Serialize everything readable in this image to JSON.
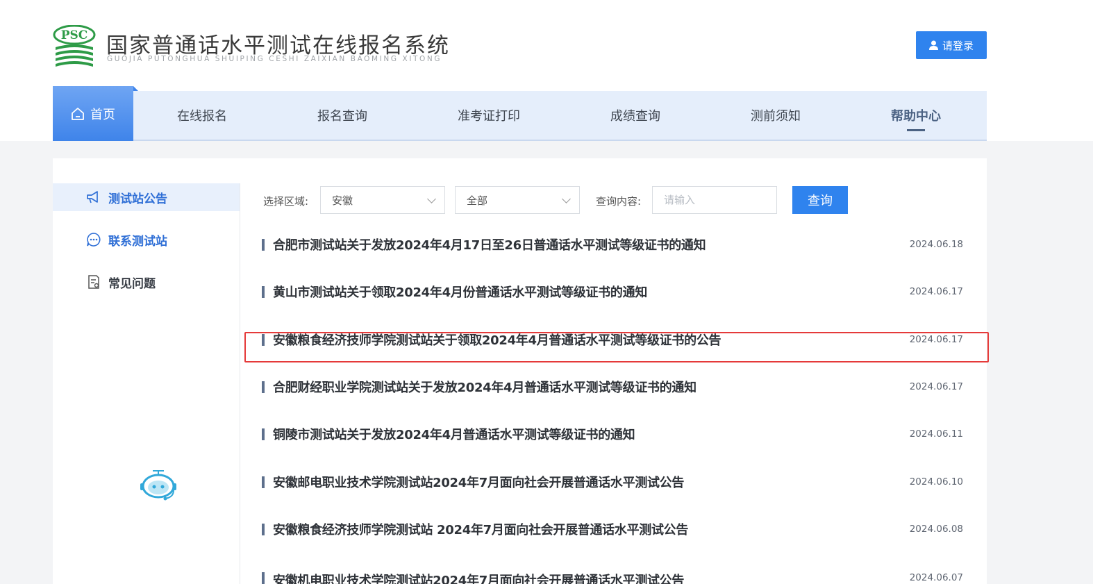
{
  "header": {
    "logo_text": "PSC",
    "title": "国家普通话水平测试在线报名系统",
    "subtitle": "GUOJIA PUTONGHUA SHUIPING CESHI ZAIXIAN BAOMING XITONG",
    "login_label": "请登录",
    "login_icon": "user-icon"
  },
  "nav": {
    "home_label": "首页",
    "home_icon": "home-icon",
    "items": [
      {
        "label": "在线报名"
      },
      {
        "label": "报名查询"
      },
      {
        "label": "准考证打印"
      },
      {
        "label": "成绩查询"
      },
      {
        "label": "测前须知"
      },
      {
        "label": "帮助中心"
      }
    ],
    "active_item": "帮助中心"
  },
  "sidebar": {
    "items": [
      {
        "label": "测试站公告",
        "icon": "megaphone-icon"
      },
      {
        "label": "联系测试站",
        "icon": "chat-icon"
      },
      {
        "label": "常见问题",
        "icon": "document-icon"
      }
    ],
    "active_item": "测试站公告",
    "assistant_icon": "robot-assistant-icon"
  },
  "filters": {
    "region_label": "选择区域:",
    "region_value": "安徽",
    "category_value": "全部",
    "query_label": "查询内容:",
    "query_placeholder": "请输入",
    "search_label": "查询"
  },
  "news": [
    {
      "title": "合肥市测试站关于发放2024年4月17日至26日普通话水平测试等级证书的通知",
      "date": "2024.06.18"
    },
    {
      "title": "黄山市测试站关于领取2024年4月份普通话水平测试等级证书的通知",
      "date": "2024.06.17"
    },
    {
      "title": "安徽粮食经济技师学院测试站关于领取2024年4月普通话水平测试等级证书的公告",
      "date": "2024.06.17"
    },
    {
      "title": "合肥财经职业学院测试站关于发放2024年4月普通话水平测试等级证书的通知",
      "date": "2024.06.17"
    },
    {
      "title": "铜陵市测试站关于发放2024年4月普通话水平测试等级证书的通知",
      "date": "2024.06.11"
    },
    {
      "title": "安徽邮电职业技术学院测试站2024年7月面向社会开展普通话水平测试公告",
      "date": "2024.06.10"
    },
    {
      "title": "安徽粮食经济技师学院测试站 2024年7月面向社会开展普通话水平测试公告",
      "date": "2024.06.08"
    },
    {
      "title": "安徽机电职业技术学院测试站2024年7月面向社会开展普通话水平测试公告",
      "date": "2024.06.07"
    }
  ],
  "highlighted_news_index": 2,
  "colors": {
    "accent": "#2f83ee",
    "nav_bg": "#e5eefb",
    "highlight_border": "#e53a3a",
    "logo_green": "#2e9b47"
  }
}
